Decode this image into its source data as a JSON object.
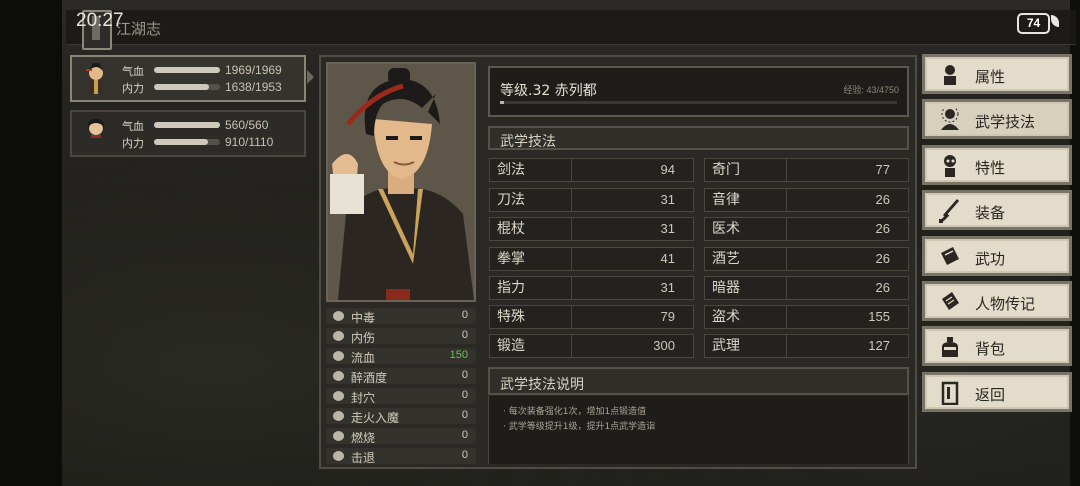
{
  "status_bar": {
    "time": "20:27",
    "battery": "74"
  },
  "top": {
    "title": "江湖志"
  },
  "party": [
    {
      "hp_label": "气血",
      "hp": "1969/1969",
      "hp_fraction": 1.0,
      "mp_label": "内力",
      "mp": "1638/1953",
      "mp_fraction": 0.84
    },
    {
      "hp_label": "气血",
      "hp": "560/560",
      "hp_fraction": 1.0,
      "mp_label": "内力",
      "mp": "910/1110",
      "mp_fraction": 0.82
    }
  ],
  "character": {
    "level_line": "等级.32 赤列都",
    "exp_text": "经验: 43/4750",
    "exp_fraction": 0.01
  },
  "status_effects": [
    {
      "label": "中毒",
      "value": "0"
    },
    {
      "label": "内伤",
      "value": "0"
    },
    {
      "label": "流血",
      "value": "150"
    },
    {
      "label": "醉酒度",
      "value": "0"
    },
    {
      "label": "封穴",
      "value": "0"
    },
    {
      "label": "走火入魔",
      "value": "0"
    },
    {
      "label": "燃烧",
      "value": "0"
    },
    {
      "label": "击退",
      "value": "0"
    }
  ],
  "skills_section": {
    "title": "武学技法"
  },
  "skills_left": [
    {
      "name": "剑法",
      "value": "94"
    },
    {
      "name": "刀法",
      "value": "31"
    },
    {
      "name": "棍杖",
      "value": "31"
    },
    {
      "name": "拳掌",
      "value": "41"
    },
    {
      "name": "指力",
      "value": "31"
    },
    {
      "name": "特殊",
      "value": "79"
    },
    {
      "name": "锻造",
      "value": "300"
    }
  ],
  "skills_right": [
    {
      "name": "奇门",
      "value": "77"
    },
    {
      "name": "音律",
      "value": "26"
    },
    {
      "name": "医术",
      "value": "26"
    },
    {
      "name": "酒艺",
      "value": "26"
    },
    {
      "name": "暗器",
      "value": "26"
    },
    {
      "name": "盗术",
      "value": "155"
    },
    {
      "name": "武理",
      "value": "127"
    }
  ],
  "description": {
    "title": "武学技法说明",
    "lines": [
      "· 每次装备强化1次，增加1点锻造值",
      "· 武学等级提升1级，提升1点武学造诣"
    ]
  },
  "menu": [
    {
      "label": "属性",
      "icon": "character-icon"
    },
    {
      "label": "武学技法",
      "icon": "meditate-icon"
    },
    {
      "label": "特性",
      "icon": "trait-icon"
    },
    {
      "label": "装备",
      "icon": "sword-icon"
    },
    {
      "label": "武功",
      "icon": "book-icon"
    },
    {
      "label": "人物传记",
      "icon": "scroll-icon"
    },
    {
      "label": "背包",
      "icon": "bag-icon"
    },
    {
      "label": "返回",
      "icon": "door-icon"
    }
  ]
}
